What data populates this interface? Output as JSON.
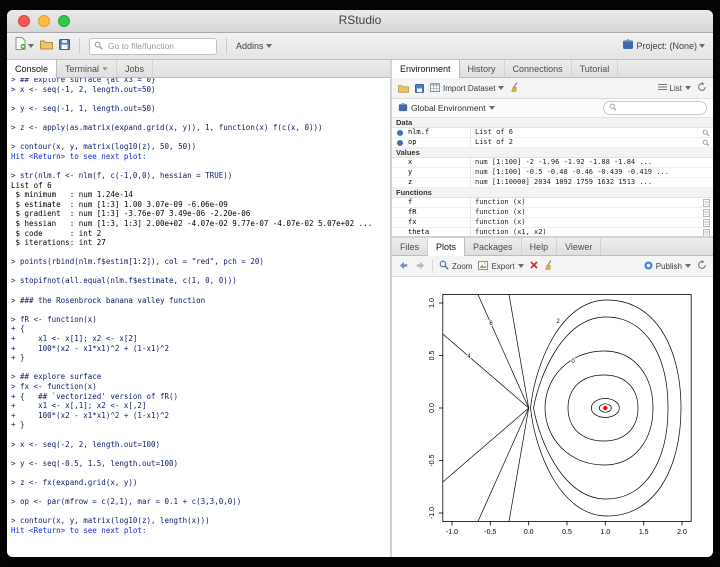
{
  "window": {
    "title": "RStudio"
  },
  "toolbar": {
    "goto_placeholder": "Go to file/function",
    "addins_label": "Addins",
    "project_label": "Project: (None)"
  },
  "console": {
    "tabs": [
      "Console",
      "Terminal",
      "Jobs"
    ],
    "active_tab": "Console",
    "lines": [
      {
        "t": "cmd",
        "x": "> ## explore surface {at x3 = 0}"
      },
      {
        "t": "cmd",
        "x": "> x <- seq(-1, 2, length.out=50)"
      },
      {
        "t": "out",
        "x": ""
      },
      {
        "t": "cmd",
        "x": "> y <- seq(-1, 1, length.out=50)"
      },
      {
        "t": "out",
        "x": ""
      },
      {
        "t": "cmd",
        "x": "> z <- apply(as.matrix(expand.grid(x, y)), 1, function(x) f(c(x, 0)))"
      },
      {
        "t": "out",
        "x": ""
      },
      {
        "t": "cmd",
        "x": "> contour(x, y, matrix(log10(z), 50, 50))"
      },
      {
        "t": "msg",
        "x": "Hit <Return> to see next plot: "
      },
      {
        "t": "out",
        "x": ""
      },
      {
        "t": "cmd",
        "x": "> str(nlm.f <- nlm(f, c(-1,0,0), hessian = TRUE))"
      },
      {
        "t": "out",
        "x": "List of 6"
      },
      {
        "t": "out",
        "x": " $ minimum   : num 1.24e-14"
      },
      {
        "t": "out",
        "x": " $ estimate  : num [1:3] 1.00 3.07e-09 -6.06e-09"
      },
      {
        "t": "out",
        "x": " $ gradient  : num [1:3] -3.76e-07 3.49e-06 -2.20e-06"
      },
      {
        "t": "out",
        "x": " $ hessian   : num [1:3, 1:3] 2.00e+02 -4.07e-02 9.77e-07 -4.07e-02 5.07e+02 ..."
      },
      {
        "t": "out",
        "x": " $ code      : int 2"
      },
      {
        "t": "out",
        "x": " $ iterations: int 27"
      },
      {
        "t": "out",
        "x": ""
      },
      {
        "t": "cmd",
        "x": "> points(rbind(nlm.f$estim[1:2]), col = \"red\", pch = 20)"
      },
      {
        "t": "out",
        "x": ""
      },
      {
        "t": "cmd",
        "x": "> stopifnot(all.equal(nlm.f$estimate, c(1, 0, 0)))"
      },
      {
        "t": "out",
        "x": ""
      },
      {
        "t": "cmd",
        "x": "> ### the Rosenbrock banana valley function"
      },
      {
        "t": "out",
        "x": ""
      },
      {
        "t": "cmd",
        "x": "> fR <- function(x)"
      },
      {
        "t": "cmd",
        "x": "+ {"
      },
      {
        "t": "cmd",
        "x": "+     x1 <- x[1]; x2 <- x[2]"
      },
      {
        "t": "cmd",
        "x": "+     100*(x2 - x1*x1)^2 + (1-x1)^2"
      },
      {
        "t": "cmd",
        "x": "+ }"
      },
      {
        "t": "out",
        "x": ""
      },
      {
        "t": "cmd",
        "x": "> ## explore surface"
      },
      {
        "t": "cmd",
        "x": "> fx <- function(x)"
      },
      {
        "t": "cmd",
        "x": "+ {   ## `vectorized' version of fR()"
      },
      {
        "t": "cmd",
        "x": "+     x1 <- x[,1]; x2 <- x[,2]"
      },
      {
        "t": "cmd",
        "x": "+     100*(x2 - x1*x1)^2 + (1-x1)^2"
      },
      {
        "t": "cmd",
        "x": "+ }"
      },
      {
        "t": "out",
        "x": ""
      },
      {
        "t": "cmd",
        "x": "> x <- seq(-2, 2, length.out=100)"
      },
      {
        "t": "out",
        "x": ""
      },
      {
        "t": "cmd",
        "x": "> y <- seq(-0.5, 1.5, length.out=100)"
      },
      {
        "t": "out",
        "x": ""
      },
      {
        "t": "cmd",
        "x": "> z <- fx(expand.grid(x, y))"
      },
      {
        "t": "out",
        "x": ""
      },
      {
        "t": "cmd",
        "x": "> op <- par(mfrow = c(2,1), mar = 0.1 + c(3,3,0,0))"
      },
      {
        "t": "out",
        "x": ""
      },
      {
        "t": "cmd",
        "x": "> contour(x, y, matrix(log10(z), length(x)))"
      },
      {
        "t": "msg",
        "x": "Hit <Return> to see next plot: "
      }
    ]
  },
  "environment": {
    "tabs": [
      "Environment",
      "History",
      "Connections",
      "Tutorial"
    ],
    "active_tab": "Environment",
    "toolbar": {
      "import_label": "Import Dataset",
      "list_label": "List"
    },
    "scope": "Global Environment",
    "sections": [
      {
        "name": "Data",
        "kind": "data",
        "rows": [
          {
            "name": "nlm.f",
            "value": "List of 6"
          },
          {
            "name": "op",
            "value": "List of 2"
          }
        ]
      },
      {
        "name": "Values",
        "kind": "values",
        "rows": [
          {
            "name": "x",
            "value": "num [1:100] -2 -1.96 -1.92 -1.88 -1.84 ..."
          },
          {
            "name": "y",
            "value": "num [1:100] -0.5 -0.48 -0.46 -0.439 -0.419 ..."
          },
          {
            "name": "z",
            "value": "num [1:10000] 2034 1892 1759 1632 1513 ..."
          }
        ]
      },
      {
        "name": "Functions",
        "kind": "functions",
        "rows": [
          {
            "name": "f",
            "value": "function (x)"
          },
          {
            "name": "fR",
            "value": "function (x)"
          },
          {
            "name": "fx",
            "value": "function (x)"
          },
          {
            "name": "theta",
            "value": "function (x1, x2)"
          }
        ]
      }
    ]
  },
  "plots": {
    "tabs": [
      "Files",
      "Plots",
      "Packages",
      "Help",
      "Viewer"
    ],
    "active_tab": "Plots",
    "toolbar": {
      "zoom_label": "Zoom",
      "export_label": "Export",
      "publish_label": "Publish"
    },
    "plot": {
      "x_tick_labels": [
        "-1.0",
        "-0.5",
        "0.0",
        "0.5",
        "1.0",
        "1.5",
        "2.0"
      ],
      "y_tick_labels": [
        "-1.0",
        "-0.5",
        "0.0",
        "0.5",
        "1.0"
      ],
      "contour_labels": [
        "6",
        "4",
        "2",
        "0"
      ],
      "point_color": "#ff0000"
    }
  },
  "chart_data": {
    "type": "contour",
    "title": "",
    "xlabel": "",
    "ylabel": "",
    "xlim": [
      -1.0,
      2.0
    ],
    "ylim": [
      -1.0,
      1.0
    ],
    "x_ticks": [
      -1.0,
      -0.5,
      0.0,
      0.5,
      1.0,
      1.5,
      2.0
    ],
    "y_ticks": [
      -1.0,
      -0.5,
      0.0,
      0.5,
      1.0
    ],
    "contour_label_values": [
      6,
      4,
      2,
      0
    ],
    "marked_point": {
      "x": 1.0,
      "y": 0.0,
      "color": "#ff0000"
    }
  }
}
